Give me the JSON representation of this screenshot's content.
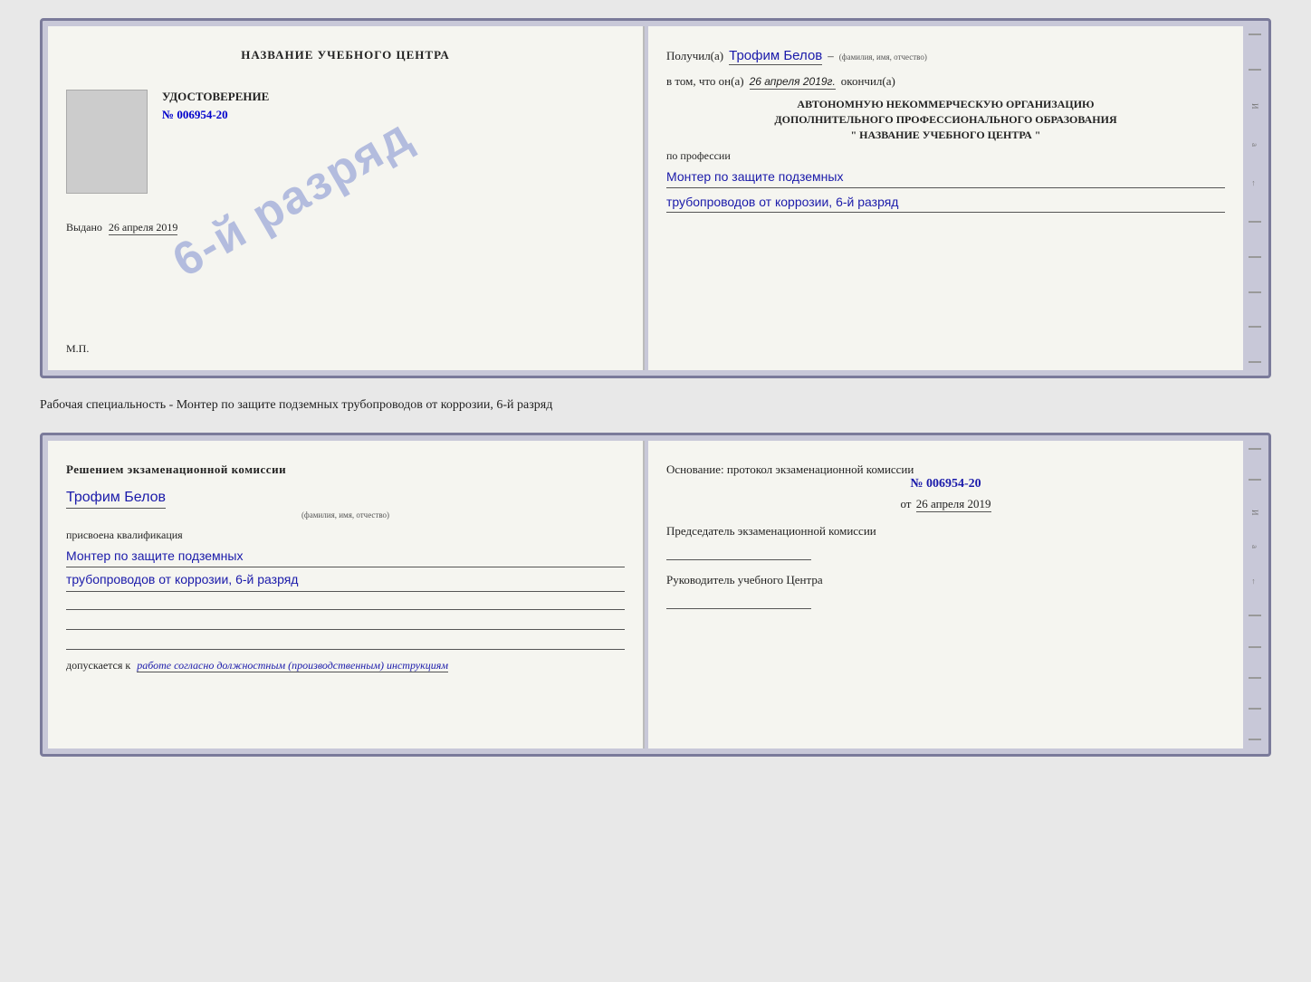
{
  "top_doc": {
    "left": {
      "header": "НАЗВАНИЕ УЧЕБНОГО ЦЕНТРА",
      "cert_title": "УДОСТОВЕРЕНИЕ",
      "cert_number": "№ 006954-20",
      "issued_label": "Выдано",
      "issued_date": "26 апреля 2019",
      "mp_label": "М.П.",
      "stamp_text": "6-й разряд"
    },
    "right": {
      "received_label": "Получил(а)",
      "recipient_name": "Трофим Белов",
      "name_sub": "(фамилия, имя, отчество)",
      "in_that_label": "в том, что он(а)",
      "completion_date": "26 апреля 2019г.",
      "finished_label": "окончил(а)",
      "institution_line1": "АВТОНОМНУЮ НЕКОММЕРЧЕСКУЮ ОРГАНИЗАЦИЮ",
      "institution_line2": "ДОПОЛНИТЕЛЬНОГО ПРОФЕССИОНАЛЬНОГО ОБРАЗОВАНИЯ",
      "institution_line3": "\"  НАЗВАНИЕ УЧЕБНОГО ЦЕНТРА  \"",
      "profession_label": "по профессии",
      "profession_line1": "Монтер по защите подземных",
      "profession_line2": "трубопроводов от коррозии, 6-й разряд"
    }
  },
  "between_text": "Рабочая специальность - Монтер по защите подземных трубопроводов от коррозии, 6-й разряд",
  "bottom_doc": {
    "left": {
      "decision_title": "Решением экзаменационной комиссии",
      "person_name": "Трофим Белов",
      "name_sub": "(фамилия, имя, отчество)",
      "qualification_label": "присвоена квалификация",
      "qualification_line1": "Монтер по защите подземных",
      "qualification_line2": "трубопроводов от коррозии, 6-й разряд",
      "допускается_prefix": "допускается к",
      "допускается_value": "работе согласно должностным (производственным) инструкциям"
    },
    "right": {
      "osnowanie_title": "Основание: протокол экзаменационной комиссии",
      "protocol_number": "№ 006954-20",
      "date_prefix": "от",
      "date_value": "26 апреля 2019",
      "chairman_title": "Председатель экзаменационной комиссии",
      "rukovoditel_title": "Руководитель учебного Центра"
    }
  },
  "side_chars": [
    "И",
    "а",
    "←",
    "–",
    "–",
    "–",
    "–",
    "–"
  ]
}
